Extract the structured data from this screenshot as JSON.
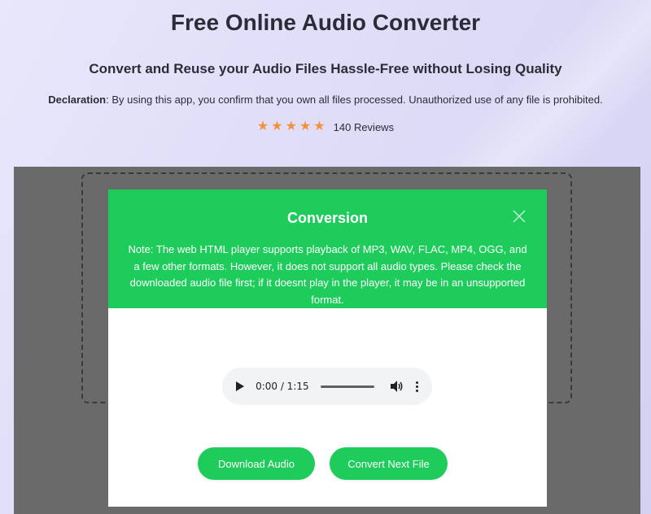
{
  "header": {
    "title": "Free Online Audio Converter",
    "subtitle": "Convert and Reuse your Audio Files Hassle-Free without Losing Quality",
    "declaration_label": "Declaration",
    "declaration_text": ": By using this app, you confirm that you own all files processed. Unauthorized use of any file is prohibited.",
    "rating": {
      "stars": 5,
      "reviews": "140 Reviews"
    }
  },
  "modal": {
    "title": "Conversion",
    "note": "Note: The web HTML player supports playback of MP3, WAV, FLAC, MP4, OGG, and a few other formats. However, it does not support all audio types. Please check the downloaded audio file first; if it doesnt play in the player, it may be in an unsupported format.",
    "close_icon": "close-icon",
    "player": {
      "time": "0:00 / 1:15",
      "progress": 0
    },
    "buttons": {
      "download": "Download Audio",
      "convert_next": "Convert Next File"
    }
  },
  "colors": {
    "accent": "#1ecc5c",
    "star": "#f4913b",
    "overlay": "#6a6a6a"
  }
}
